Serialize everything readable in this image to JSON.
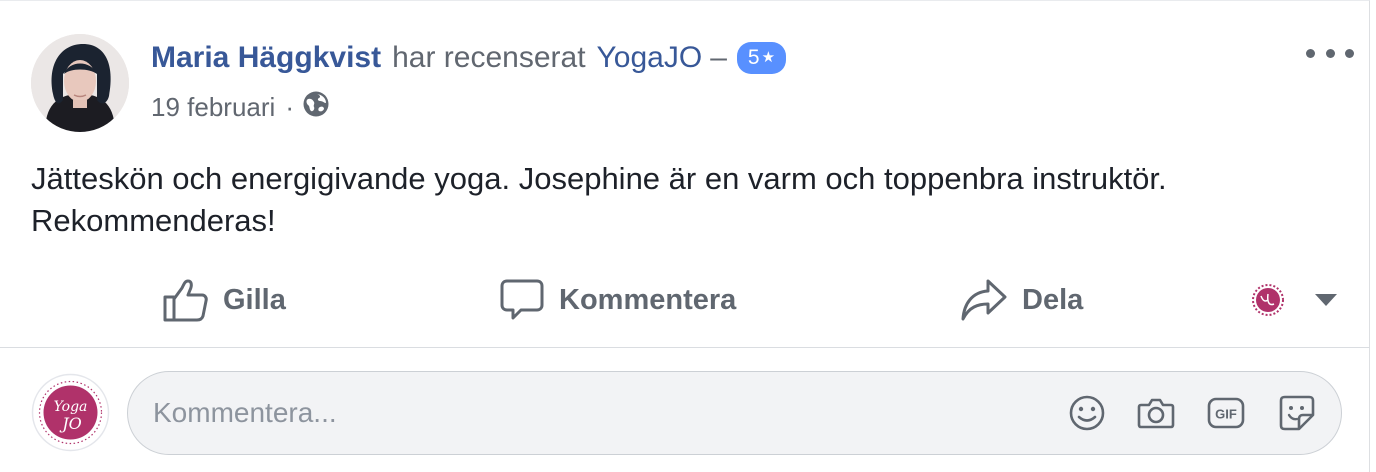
{
  "post": {
    "author": "Maria Häggkvist",
    "verb": "har recenserat",
    "page": "YogaJO",
    "dash": "–",
    "rating": "5",
    "rating_star": "★",
    "date": "19 februari",
    "meta_sep": "·",
    "privacy_icon": "globe-icon",
    "text_line1": "Jätteskön och energigivande yoga. Josephine är en varm och toppenbra instruktör.",
    "text_line2": "Rekommenderas!"
  },
  "actions": {
    "like_label": "Gilla",
    "comment_label": "Kommentera",
    "share_label": "Dela",
    "like_icon": "thumbs-up-icon",
    "comment_icon": "speech-bubble-icon",
    "share_icon": "share-arrow-icon",
    "select_icon": "chevron-down-icon"
  },
  "comment": {
    "placeholder": "Kommentera...",
    "icons": [
      "emoji-icon",
      "camera-icon",
      "gif-icon",
      "sticker-icon"
    ]
  },
  "colors": {
    "link": "#385898",
    "muted": "#616770",
    "badge": "#5890ff",
    "brand": "#b0326a"
  }
}
